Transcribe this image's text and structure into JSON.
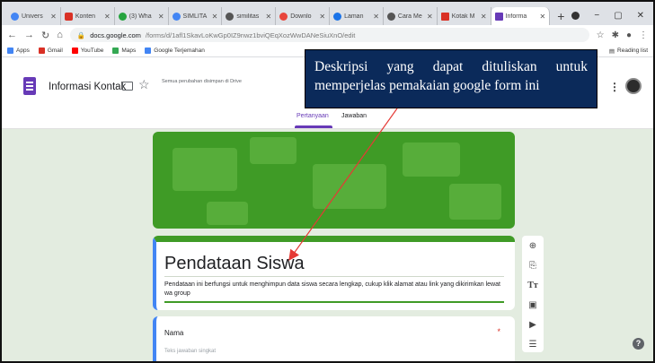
{
  "browser": {
    "tabs": [
      {
        "label": "Univers",
        "color": "#4285f4"
      },
      {
        "label": "Konten",
        "color": "#d93025"
      },
      {
        "label": "(3) Wha",
        "color": "#25a33e"
      },
      {
        "label": "SIMLITA",
        "color": "#4285f4"
      },
      {
        "label": "similitas",
        "color": "#555555"
      },
      {
        "label": "Downlo",
        "color": "#e8453c"
      },
      {
        "label": "Laman",
        "color": "#1a73e8"
      },
      {
        "label": "Cara Me",
        "color": "#555555"
      },
      {
        "label": "Kotak M",
        "color": "#d93025"
      },
      {
        "label": "Informa",
        "color": "#673ab7"
      }
    ],
    "url_host": "docs.google.com",
    "url_path": "/forms/d/1afl1SkavLoKwGp0IZ9nwz1bviQEqXozWwDANeSiuXnO/edit",
    "bookmarks": [
      {
        "label": "Apps",
        "color": "#4285f4"
      },
      {
        "label": "Gmail",
        "color": "#d93025"
      },
      {
        "label": "YouTube",
        "color": "#ff0000"
      },
      {
        "label": "Maps",
        "color": "#34a853"
      },
      {
        "label": "Google Terjemahan",
        "color": "#4285f4"
      }
    ],
    "reading_list": "Reading list"
  },
  "forms": {
    "doc_title": "Informasi Kontak",
    "save_status": "Semua perubahan disimpan di Drive",
    "tab_questions": "Pertanyaan",
    "tab_answers": "Jawaban",
    "form_title": "Pendataan Siswa",
    "form_description": "Pendataan ini berfungsi untuk menghimpun data siswa secara lengkap, cukup klik alamat atau link yang dikirimkan lewat wa group",
    "question_label": "Nama",
    "required_mark": "*",
    "answer_hint": "Teks jawaban singkat",
    "theme_color": "#3f9b26",
    "accent_color": "#673ab7"
  },
  "annotation": {
    "text": "Deskripsi yang dapat dituliskan untuk memperjelas pemakaian google form ini",
    "box_color": "#0b2a5a",
    "arrow_color": "#e53935"
  },
  "icons": [
    "back-icon",
    "forward-icon",
    "reload-icon",
    "home-icon",
    "lock-icon",
    "folder-icon",
    "star-icon",
    "add-question-icon",
    "import-icon",
    "title-text-icon",
    "image-icon",
    "video-icon",
    "section-icon",
    "help-icon"
  ]
}
